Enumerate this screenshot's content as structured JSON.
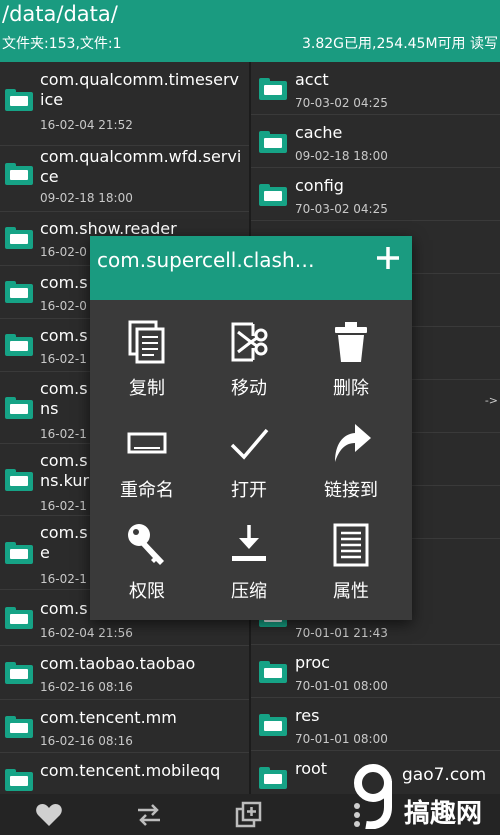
{
  "header": {
    "path": "/data/data/",
    "counts": "文件夹:153,文件:1",
    "storage": "3.82G已用,254.45M可用 读写"
  },
  "left_list": [
    {
      "name": "com.qualcomm.timeservice",
      "date": "16-02-04 21:52"
    },
    {
      "name": "com.qualcomm.wfd.service",
      "date": "09-02-18 18:00"
    },
    {
      "name": "com.show.reader",
      "date": "16-02-0"
    },
    {
      "name": "com.s",
      "date": "16-02-0"
    },
    {
      "name": "com.s",
      "date": "16-02-1"
    },
    {
      "name": "com.s ns",
      "date": "16-02-1"
    },
    {
      "name": "com.s ns.kur",
      "date": "16-02-1"
    },
    {
      "name": "com.s e",
      "date": "16-02-1"
    },
    {
      "name": "com.s",
      "date": "16-02-04 21:56"
    },
    {
      "name": "com.taobao.taobao",
      "date": "16-02-16 08:16"
    },
    {
      "name": "com.tencent.mm",
      "date": "16-02-16 08:16"
    },
    {
      "name": "com.tencent.mobileqq",
      "date": ""
    }
  ],
  "right_list": [
    {
      "name": "acct",
      "date": "70-03-02 04:25"
    },
    {
      "name": "cache",
      "date": "09-02-18 18:00"
    },
    {
      "name": "config",
      "date": "70-03-02 04:25"
    },
    {
      "name": "",
      "date": ""
    },
    {
      "name": "",
      "date": ""
    },
    {
      "name": "",
      "date": ""
    },
    {
      "name": "",
      "date": ""
    },
    {
      "name": "",
      "date": ""
    },
    {
      "name": "",
      "date": ""
    },
    {
      "name": "",
      "date": "70-01-01 21:43"
    },
    {
      "name": "proc",
      "date": "70-01-01 08:00"
    },
    {
      "name": "res",
      "date": "70-01-01 08:00"
    },
    {
      "name": "root",
      "date": ""
    }
  ],
  "arrow_hint": "->",
  "dialog": {
    "title": "com.supercell.clash…",
    "add_icon": "plus-icon",
    "actions": [
      {
        "label": "复制",
        "icon": "copy-icon"
      },
      {
        "label": "移动",
        "icon": "cut-icon"
      },
      {
        "label": "删除",
        "icon": "trash-icon"
      },
      {
        "label": "重命名",
        "icon": "rename-icon"
      },
      {
        "label": "打开",
        "icon": "check-icon"
      },
      {
        "label": "链接到",
        "icon": "link-arrow-icon"
      },
      {
        "label": "权限",
        "icon": "key-icon"
      },
      {
        "label": "压缩",
        "icon": "compress-icon"
      },
      {
        "label": "属性",
        "icon": "properties-icon"
      }
    ]
  },
  "bottom_bar": {
    "icons": [
      "heart-icon",
      "swap-icon",
      "add-window-icon",
      "menu-icon"
    ]
  },
  "watermark": {
    "site": "gao7.com",
    "name": "搞趣网"
  },
  "colors": {
    "accent": "#1a9b80",
    "folder": "#16a386",
    "background": "#2b2b2b",
    "dialog": "#3a3a3a"
  }
}
